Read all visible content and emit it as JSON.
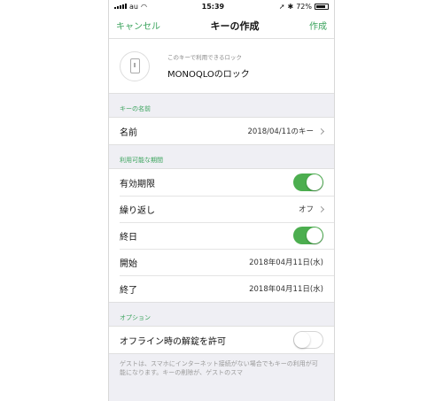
{
  "status_bar": {
    "carrier": "au",
    "time": "15:39",
    "battery": "72%"
  },
  "nav": {
    "cancel": "キャンセル",
    "title": "キーの作成",
    "create": "作成"
  },
  "lock": {
    "caption": "このキーで利用できるロック",
    "name": "MONOQLOのロック"
  },
  "sections": {
    "key_name": "キーの名前",
    "period": "利用可能な期間",
    "options": "オプション"
  },
  "key_name_row": {
    "label": "名前",
    "value": "2018/04/11のキー"
  },
  "period_rows": {
    "validity": {
      "label": "有効期限",
      "toggle": "on"
    },
    "repeat": {
      "label": "繰り返し",
      "value": "オフ"
    },
    "all_day": {
      "label": "終日",
      "toggle": "on"
    },
    "start": {
      "label": "開始",
      "value": "2018年04月11日(水)"
    },
    "end": {
      "label": "終了",
      "value": "2018年04月11日(水)"
    }
  },
  "options_rows": {
    "offline": {
      "label": "オフライン時の解錠を許可",
      "toggle": "off"
    }
  },
  "footnote": "ゲストは、スマホにインターネット接続がない場合でもキーの利用が可能になります。キーの削除が、ゲストのスマ",
  "colors": {
    "accent": "#3aa35c",
    "toggle_on": "#4cae4f"
  }
}
